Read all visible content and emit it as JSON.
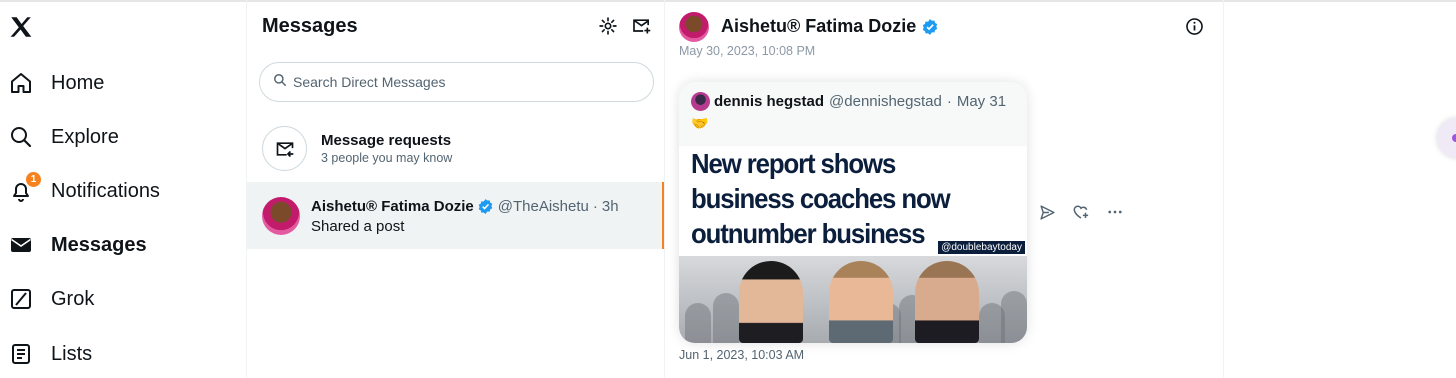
{
  "nav": {
    "logo": "x-logo-icon",
    "items": [
      {
        "label": "Home",
        "icon": "home-icon"
      },
      {
        "label": "Explore",
        "icon": "search-icon"
      },
      {
        "label": "Notifications",
        "icon": "bell-icon",
        "badge": "1"
      },
      {
        "label": "Messages",
        "icon": "envelope-icon",
        "active": true
      },
      {
        "label": "Grok",
        "icon": "grok-icon"
      },
      {
        "label": "Lists",
        "icon": "list-icon"
      }
    ]
  },
  "messages": {
    "title": "Messages",
    "settings_icon": "gear-icon",
    "compose_icon": "new-message-icon",
    "search": {
      "placeholder": "Search Direct Messages",
      "value": ""
    },
    "requests": {
      "title": "Message requests",
      "subtitle": "3 people you may know"
    },
    "conversations": [
      {
        "name": "Aishetu® Fatima Dozie",
        "verified": true,
        "handle": "@TheAishetu",
        "time": "3h",
        "preview": "Shared a post"
      }
    ]
  },
  "chat": {
    "name": "Aishetu® Fatima Dozie",
    "verified": true,
    "timestamp_top": "May 30, 2023, 10:08 PM",
    "timestamp_bottom": "Jun 1, 2023, 10:03 AM",
    "shared_post": {
      "author": "dennis hegstad",
      "handle": "@dennishegstad",
      "date": "May 31",
      "emoji": "🤝",
      "headline": "New report shows business coaches now outnumber business owners",
      "image_tag": "@doublebaytoday"
    },
    "actions": [
      "send-icon",
      "react-heart-icon",
      "more-icon"
    ]
  },
  "colors": {
    "accent": "#1d9bf0",
    "badge": "#f6821f",
    "selected_bg": "#eff3f4",
    "headline": "#0b1f3d"
  }
}
